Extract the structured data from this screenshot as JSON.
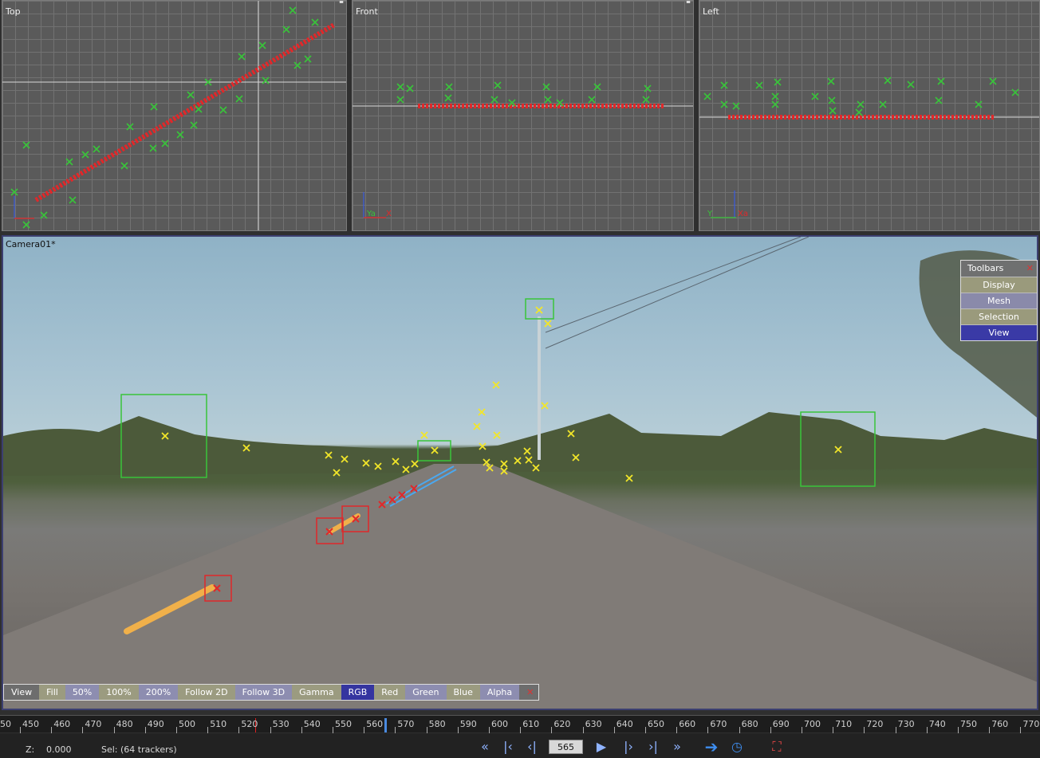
{
  "viewports": {
    "top": {
      "label": "Top",
      "axes": [
        "Y",
        "X"
      ]
    },
    "front": {
      "label": "Front",
      "axes": [
        "Ya",
        "X"
      ]
    },
    "left": {
      "label": "Left",
      "axes": [
        "Y",
        "Xa"
      ]
    }
  },
  "camera": {
    "title": "Camera01*"
  },
  "toolbars_panel": {
    "title": "Toolbars",
    "close": "✕",
    "items": [
      "Display",
      "Mesh",
      "Selection",
      "View"
    ]
  },
  "view_bar": {
    "items": [
      "View",
      "Fill",
      "50%",
      "100%",
      "200%",
      "Follow 2D",
      "Follow 3D",
      "Gamma",
      "RGB",
      "Red",
      "Green",
      "Blue",
      "Alpha"
    ],
    "close": "✕"
  },
  "timeline": {
    "first_partial": "50",
    "ticks": [
      "450",
      "460",
      "470",
      "480",
      "490",
      "500",
      "510",
      "520",
      "530",
      "540",
      "550",
      "560",
      "570",
      "580",
      "590",
      "600",
      "610",
      "620",
      "630",
      "640",
      "650",
      "660",
      "670",
      "680",
      "690",
      "700",
      "710",
      "720",
      "730",
      "740",
      "750",
      "760",
      "770"
    ],
    "current_frame": "565"
  },
  "status": {
    "z_label": "Z:",
    "z_value": "0.000",
    "selection": "Sel: (64 trackers)"
  },
  "colors": {
    "tracker_green": "#39c43a",
    "tracker_red": "#e0282a",
    "tracker_yellow": "#f2e629",
    "path_blue": "#4aa8f0",
    "path_orange": "#f0b04a",
    "accent_blue": "#3535a0"
  }
}
